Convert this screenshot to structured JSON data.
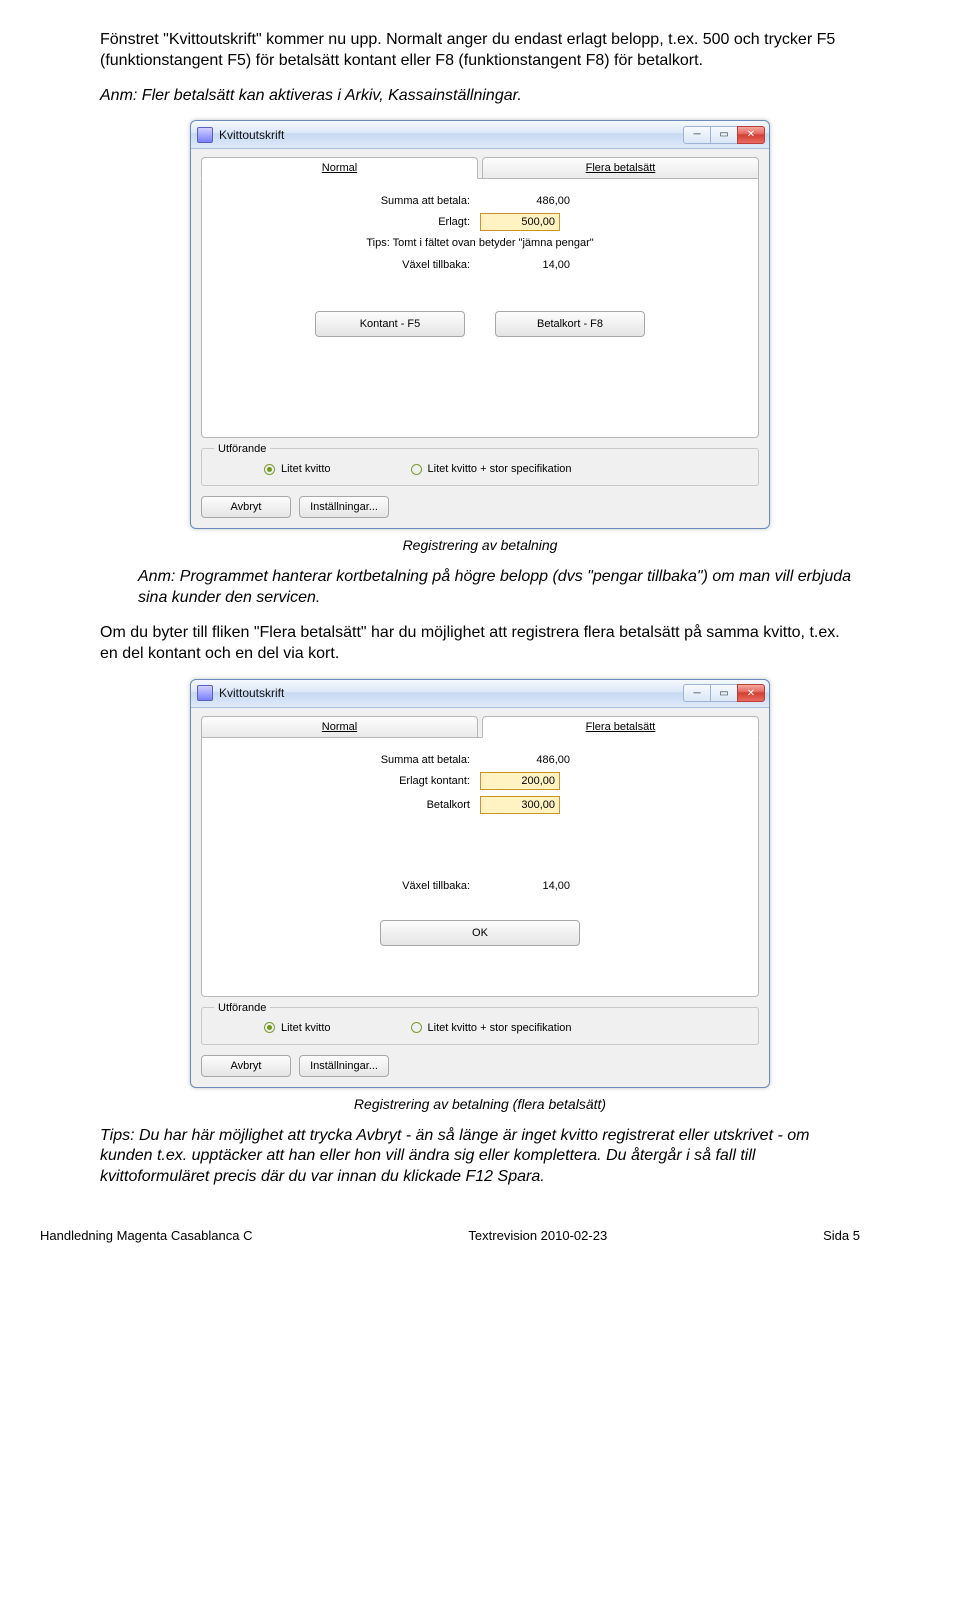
{
  "doc": {
    "p1": "Fönstret \"Kvittoutskrift\" kommer nu upp. Normalt anger du endast erlagt belopp, t.ex. 500 och trycker F5 (funktionstangent F5) för betalsätt kontant eller F8 (funktionstangent F8) för betalkort.",
    "p2": "Anm: Fler betalsätt kan aktiveras i Arkiv, Kassainställningar.",
    "caption1": "Registrering av betalning",
    "p3": "Anm: Programmet hanterar kortbetalning på högre belopp (dvs \"pengar tillbaka\") om man vill erbjuda sina kunder den servicen.",
    "p4": "Om du byter till fliken \"Flera betalsätt\" har du möjlighet att registrera flera betalsätt på samma kvitto, t.ex. en del kontant och en del via kort.",
    "caption2": "Registrering av betalning (flera betalsätt)",
    "p5": "Tips: Du har här möjlighet att trycka Avbryt - än så länge är inget kvitto registrerat eller utskrivet - om kunden t.ex. upptäcker att han eller hon vill ändra sig eller komplettera. Du återgår i så fall till kvittoformuläret precis där du var innan du klickade F12 Spara."
  },
  "win1": {
    "title": "Kvittoutskrift",
    "tab_normal": "Normal",
    "tab_flera": "Flera betalsätt",
    "lbl_summa": "Summa att betala:",
    "val_summa": "486,00",
    "lbl_erlagt": "Erlagt:",
    "val_erlagt": "500,00",
    "tip": "Tips: Tomt i fältet ovan betyder \"jämna pengar\"",
    "lbl_vaxel": "Växel tillbaka:",
    "val_vaxel": "14,00",
    "btn_kontant": "Kontant - F5",
    "btn_betalkort": "Betalkort - F8",
    "fieldset": "Utförande",
    "radio1": "Litet kvitto",
    "radio2": "Litet kvitto + stor specifikation",
    "btn_avbryt": "Avbryt",
    "btn_inst": "Inställningar..."
  },
  "win2": {
    "title": "Kvittoutskrift",
    "tab_normal": "Normal",
    "tab_flera": "Flera betalsätt",
    "lbl_summa": "Summa att betala:",
    "val_summa": "486,00",
    "lbl_erlagt_kontant": "Erlagt kontant:",
    "val_erlagt_kontant": "200,00",
    "lbl_betalkort": "Betalkort",
    "val_betalkort": "300,00",
    "lbl_vaxel": "Växel tillbaka:",
    "val_vaxel": "14,00",
    "btn_ok": "OK",
    "fieldset": "Utförande",
    "radio1": "Litet kvitto",
    "radio2": "Litet kvitto + stor specifikation",
    "btn_avbryt": "Avbryt",
    "btn_inst": "Inställningar..."
  },
  "footer": {
    "left": "Handledning Magenta Casablanca C",
    "mid": "Textrevision 2010-02-23",
    "right": "Sida 5"
  }
}
